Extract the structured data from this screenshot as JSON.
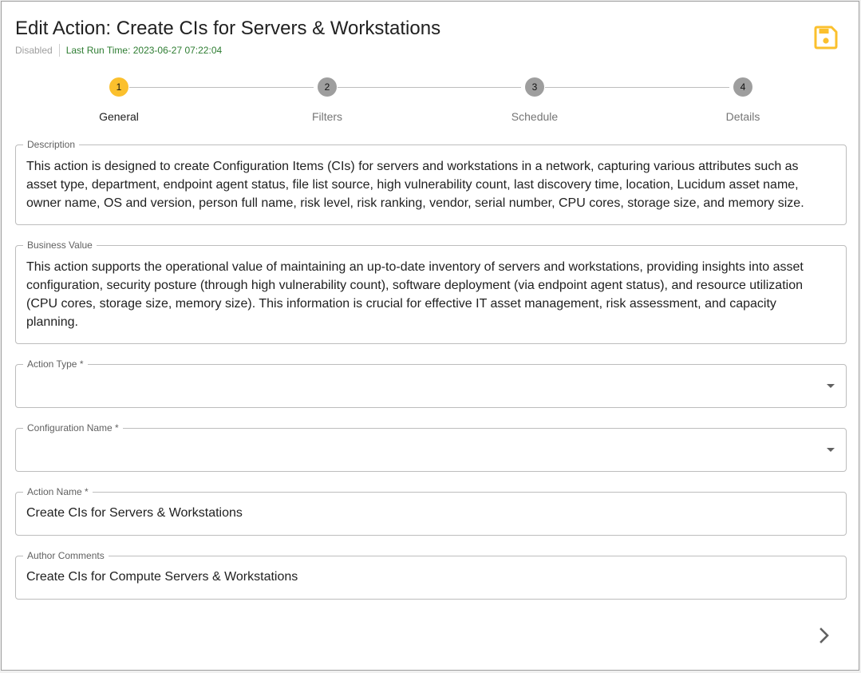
{
  "header": {
    "title": "Edit Action: Create CIs for Servers & Workstations",
    "status": "Disabled",
    "last_run": "Last Run Time: 2023-06-27 07:22:04",
    "save_icon": "floppy-disk-icon"
  },
  "colors": {
    "accent": "#fbc02d",
    "status_green": "#2e7d32",
    "inactive_step": "#9e9e9e"
  },
  "stepper": {
    "steps": [
      {
        "number": "1",
        "label": "General"
      },
      {
        "number": "2",
        "label": "Filters"
      },
      {
        "number": "3",
        "label": "Schedule"
      },
      {
        "number": "4",
        "label": "Details"
      }
    ],
    "active_step": "1"
  },
  "form": {
    "description": {
      "label": "Description",
      "value": "This action is designed to create Configuration Items (CIs) for servers and workstations in a network, capturing various attributes such as asset type, department, endpoint agent status, file list source, high vulnerability count, last discovery time, location, Lucidum asset name, owner name, OS and version, person full name, risk level, risk ranking, vendor, serial number, CPU cores, storage size, and memory size."
    },
    "business_value": {
      "label": "Business Value",
      "value": "This action supports the operational value of maintaining an up-to-date inventory of servers and workstations, providing insights into asset configuration, security posture (through high vulnerability count), software deployment (via endpoint agent status), and resource utilization (CPU cores, storage size, memory size). This information is crucial for effective IT asset management, risk assessment, and capacity planning."
    },
    "action_type": {
      "label": "Action Type *",
      "value": ""
    },
    "configuration_name": {
      "label": "Configuration Name *",
      "value": ""
    },
    "action_name": {
      "label": "Action Name *",
      "value": "Create CIs for Servers & Workstations"
    },
    "author_comments": {
      "label": "Author Comments",
      "value": "Create CIs for Compute Servers & Workstations"
    }
  },
  "footer": {
    "next_icon": "chevron-right-icon"
  }
}
